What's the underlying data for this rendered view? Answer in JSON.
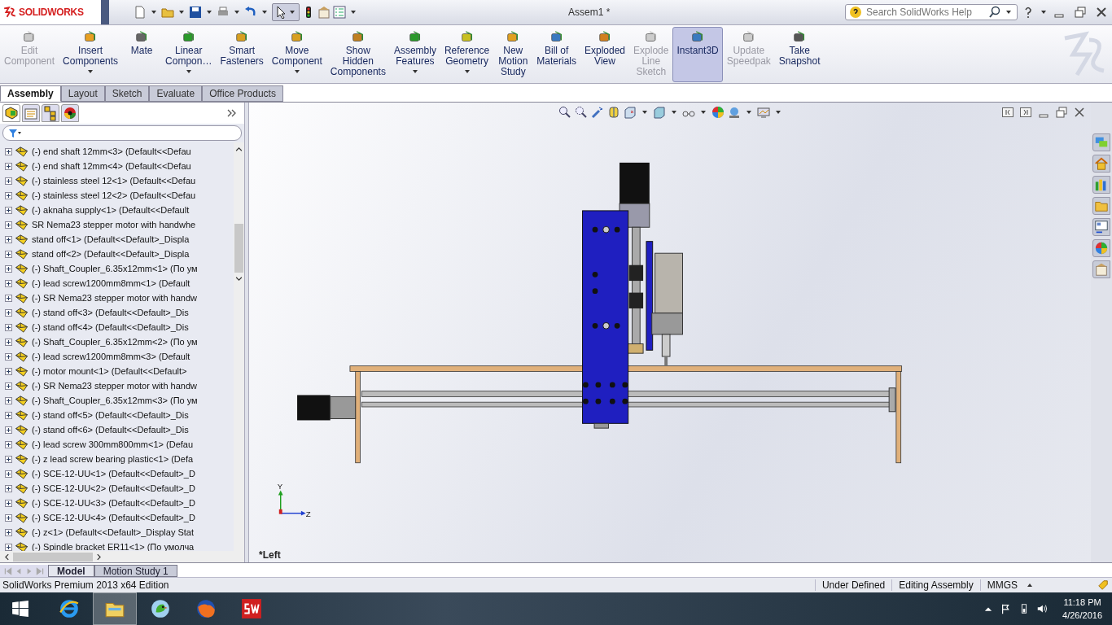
{
  "app_logo": {
    "text": "SOLIDWORKS"
  },
  "title_bar": {
    "document_title": "Assem1 *",
    "search": {
      "placeholder": "Search SolidWorks Help"
    }
  },
  "ribbon": [
    {
      "lines": [
        "Edit",
        "Component"
      ],
      "disabled": true,
      "selected": false,
      "dropdown": false
    },
    {
      "lines": [
        "Insert",
        "Components"
      ],
      "disabled": false,
      "selected": false,
      "dropdown": true
    },
    {
      "lines": [
        "Mate"
      ],
      "disabled": false,
      "selected": false,
      "dropdown": false
    },
    {
      "lines": [
        "Linear",
        "Compon…"
      ],
      "disabled": false,
      "selected": false,
      "dropdown": true
    },
    {
      "lines": [
        "Smart",
        "Fasteners"
      ],
      "disabled": false,
      "selected": false,
      "dropdown": false
    },
    {
      "lines": [
        "Move",
        "Component"
      ],
      "disabled": false,
      "selected": false,
      "dropdown": true
    },
    {
      "lines": [
        "Show",
        "Hidden",
        "Components"
      ],
      "disabled": false,
      "selected": false,
      "dropdown": false
    },
    {
      "lines": [
        "Assembly",
        "Features"
      ],
      "disabled": false,
      "selected": false,
      "dropdown": true
    },
    {
      "lines": [
        "Reference",
        "Geometry"
      ],
      "disabled": false,
      "selected": false,
      "dropdown": true
    },
    {
      "lines": [
        "New",
        "Motion",
        "Study"
      ],
      "disabled": false,
      "selected": false,
      "dropdown": false
    },
    {
      "lines": [
        "Bill of",
        "Materials"
      ],
      "disabled": false,
      "selected": false,
      "dropdown": false
    },
    {
      "lines": [
        "Exploded",
        "View"
      ],
      "disabled": false,
      "selected": false,
      "dropdown": false
    },
    {
      "lines": [
        "Explode",
        "Line",
        "Sketch"
      ],
      "disabled": true,
      "selected": false,
      "dropdown": false
    },
    {
      "lines": [
        "Instant3D"
      ],
      "disabled": false,
      "selected": true,
      "dropdown": false
    },
    {
      "lines": [
        "Update",
        "Speedpak"
      ],
      "disabled": true,
      "selected": false,
      "dropdown": false
    },
    {
      "lines": [
        "Take",
        "Snapshot"
      ],
      "disabled": false,
      "selected": false,
      "dropdown": false
    }
  ],
  "command_tabs": [
    {
      "label": "Assembly",
      "selected": true
    },
    {
      "label": "Layout",
      "selected": false
    },
    {
      "label": "Sketch",
      "selected": false
    },
    {
      "label": "Evaluate",
      "selected": false
    },
    {
      "label": "Office Products",
      "selected": false
    }
  ],
  "feature_tree": {
    "items": [
      {
        "label": "(-) end shaft 12mm<3> (Default<<Defau",
        "expanded": false
      },
      {
        "label": "(-) end shaft 12mm<4> (Default<<Defau",
        "expanded": false
      },
      {
        "label": "(-) stainless steel 12<1> (Default<<Defau",
        "expanded": false
      },
      {
        "label": "(-) stainless steel 12<2> (Default<<Defau",
        "expanded": false
      },
      {
        "label": "(-) aknaha supply<1> (Default<<Default",
        "expanded": false
      },
      {
        "label": "SR Nema23 stepper motor with handwhe",
        "expanded": false
      },
      {
        "label": "stand off<1> (Default<<Default>_Displa",
        "expanded": false
      },
      {
        "label": "stand off<2> (Default<<Default>_Displa",
        "expanded": false
      },
      {
        "label": "(-) Shaft_Coupler_6.35x12mm<1> (По ум",
        "expanded": false
      },
      {
        "label": "(-) lead screw1200mm8mm<1> (Default",
        "expanded": false
      },
      {
        "label": "(-) SR Nema23 stepper motor with handw",
        "expanded": false
      },
      {
        "label": "(-) stand off<3> (Default<<Default>_Dis",
        "expanded": false
      },
      {
        "label": "(-) stand off<4> (Default<<Default>_Dis",
        "expanded": false
      },
      {
        "label": "(-) Shaft_Coupler_6.35x12mm<2> (По ум",
        "expanded": false
      },
      {
        "label": "(-) lead screw1200mm8mm<3> (Default",
        "expanded": false
      },
      {
        "label": "(-) motor mount<1> (Default<<Default>",
        "expanded": false
      },
      {
        "label": "(-) SR Nema23 stepper motor with handw",
        "expanded": false
      },
      {
        "label": "(-) Shaft_Coupler_6.35x12mm<3> (По ум",
        "expanded": false
      },
      {
        "label": "(-) stand off<5> (Default<<Default>_Dis",
        "expanded": false
      },
      {
        "label": "(-) stand off<6> (Default<<Default>_Dis",
        "expanded": false
      },
      {
        "label": "(-) lead screw 300mm800mm<1> (Defau",
        "expanded": false
      },
      {
        "label": "(-) z lead screw bearing plastic<1> (Defa",
        "expanded": false
      },
      {
        "label": "(-) SCE-12-UU<1> (Default<<Default>_D",
        "expanded": false
      },
      {
        "label": "(-) SCE-12-UU<2> (Default<<Default>_D",
        "expanded": false
      },
      {
        "label": "(-) SCE-12-UU<3> (Default<<Default>_D",
        "expanded": false
      },
      {
        "label": "(-) SCE-12-UU<4> (Default<<Default>_D",
        "expanded": false
      },
      {
        "label": "(-) z<1> (Default<<Default>_Display Stat",
        "expanded": false
      },
      {
        "label": "(-) Spindle bracket ER11<1> (По умолча",
        "expanded": false
      }
    ]
  },
  "viewport": {
    "view_label": "*Left",
    "triad": {
      "y_label": "Y",
      "z_label": "Z"
    }
  },
  "bottom_tabs": [
    {
      "label": "Model",
      "selected": true
    },
    {
      "label": "Motion Study 1",
      "selected": false
    }
  ],
  "status_bar": {
    "edition": "SolidWorks Premium 2013 x64 Edition",
    "fields": [
      "Under Defined",
      "Editing Assembly",
      "MMGS"
    ]
  },
  "taskbar": {
    "apps": [
      {
        "kind": "browser",
        "active": false
      },
      {
        "kind": "folder",
        "active": true
      },
      {
        "kind": "bird",
        "active": false
      },
      {
        "kind": "fox",
        "active": false
      },
      {
        "kind": "cad",
        "active": false
      }
    ],
    "time": "11:18 PM",
    "date": "4/26/2016"
  }
}
